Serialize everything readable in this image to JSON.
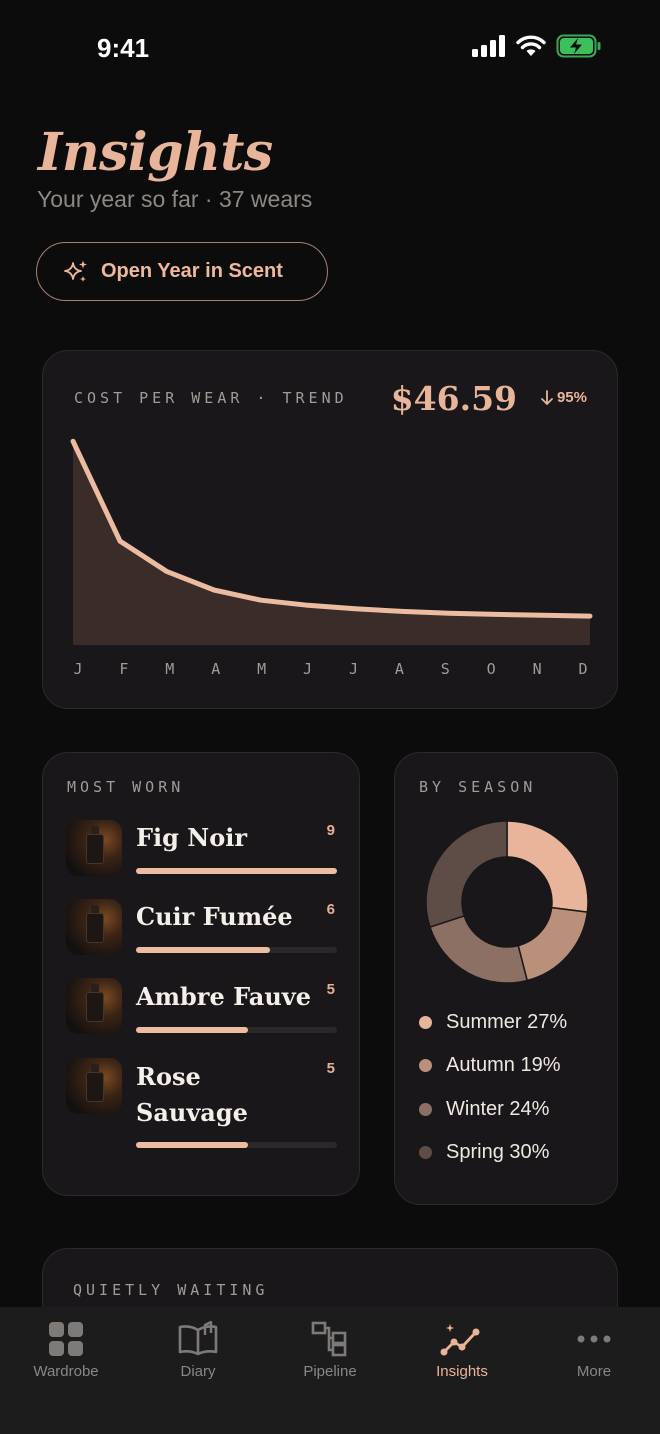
{
  "status": {
    "time": "9:41"
  },
  "header": {
    "title": "Insights",
    "subtitle": "Your year so far · 37 wears",
    "year_button": "Open Year in Scent"
  },
  "cost_per_wear": {
    "label": "COST PER WEAR · TREND",
    "value": "$46.59",
    "delta": "95%",
    "delta_direction": "down"
  },
  "chart_data": {
    "type": "area",
    "title": "",
    "categories": [
      "J",
      "F",
      "M",
      "A",
      "M",
      "J",
      "J",
      "A",
      "S",
      "O",
      "N",
      "D"
    ],
    "series": [
      {
        "values": [
          1000,
          510,
          360,
          270,
          220,
          195,
          178,
          165,
          156,
          150,
          146,
          142
        ]
      }
    ],
    "ylim": [
      0,
      1050
    ],
    "grid": false,
    "line_color": "#ebbc9f",
    "fill_color": "#3a2c29"
  },
  "most_worn": {
    "label": "MOST WORN",
    "items": [
      {
        "name": "Fig Noir",
        "count": "9",
        "fraction": 1.0
      },
      {
        "name": "Cuir Fumée",
        "count": "6",
        "fraction": 0.667
      },
      {
        "name": "Ambre Fauve",
        "count": "5",
        "fraction": 0.556
      },
      {
        "name": "Rose Sauvage",
        "count": "5",
        "fraction": 0.556
      }
    ]
  },
  "by_season": {
    "label": "BY SEASON",
    "slices": [
      {
        "name": "Summer",
        "pct_label": "Summer 27%",
        "value": 27,
        "color": "#e8b59a"
      },
      {
        "name": "Autumn",
        "pct_label": "Autumn 19%",
        "value": 19,
        "color": "#b9907a"
      },
      {
        "name": "Winter",
        "pct_label": "Winter 24%",
        "value": 24,
        "color": "#8d7064"
      },
      {
        "name": "Spring",
        "pct_label": "Spring 30%",
        "value": 30,
        "color": "#5e4c46"
      }
    ]
  },
  "quietly_waiting": {
    "label": "QUIETLY WAITING"
  },
  "tabs": [
    {
      "label": "Wardrobe",
      "icon": "grid-icon",
      "active": false
    },
    {
      "label": "Diary",
      "icon": "book-icon",
      "active": false
    },
    {
      "label": "Pipeline",
      "icon": "pipeline-icon",
      "active": false
    },
    {
      "label": "Insights",
      "icon": "trend-icon",
      "active": true
    },
    {
      "label": "More",
      "icon": "more-icon",
      "active": false
    }
  ]
}
